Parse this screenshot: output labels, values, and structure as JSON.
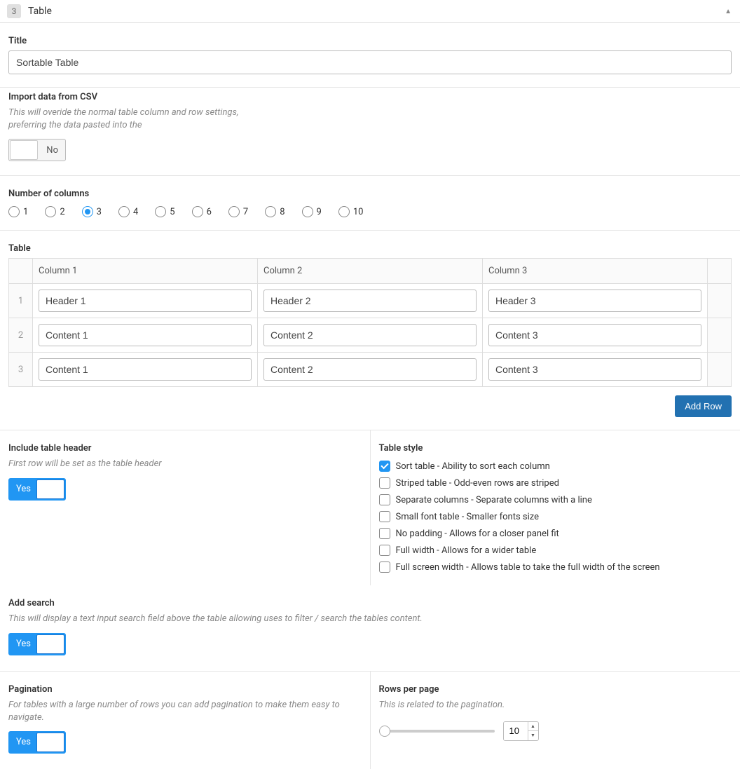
{
  "block": {
    "index": "3",
    "name": "Table",
    "collapse_icon": "▲"
  },
  "title_field": {
    "label": "Title",
    "value": "Sortable Table"
  },
  "csv": {
    "label": "Import data from CSV",
    "desc": "This will overide the normal table column and row settings, preferring the data pasted into the",
    "toggle_value": "No"
  },
  "columns": {
    "label": "Number of columns",
    "options": [
      "1",
      "2",
      "3",
      "4",
      "5",
      "6",
      "7",
      "8",
      "9",
      "10"
    ],
    "selected": "3"
  },
  "table": {
    "label": "Table",
    "headers": [
      "Column 1",
      "Column 2",
      "Column 3"
    ],
    "rows": [
      {
        "num": "1",
        "cells": [
          "Header 1",
          "Header 2",
          "Header 3"
        ]
      },
      {
        "num": "2",
        "cells": [
          "Content 1",
          "Content 2",
          "Content 3"
        ]
      },
      {
        "num": "3",
        "cells": [
          "Content 1",
          "Content 2",
          "Content 3"
        ]
      }
    ],
    "add_row_label": "Add Row"
  },
  "include_header": {
    "label": "Include table header",
    "desc": "First row will be set as the table header",
    "toggle_value": "Yes"
  },
  "style": {
    "label": "Table style",
    "options": [
      {
        "label": "Sort table - Ability to sort each column",
        "checked": true
      },
      {
        "label": "Striped table - Odd-even rows are striped",
        "checked": false
      },
      {
        "label": "Separate columns - Separate columns with a line",
        "checked": false
      },
      {
        "label": "Small font table - Smaller fonts size",
        "checked": false
      },
      {
        "label": "No padding - Allows for a closer panel fit",
        "checked": false
      },
      {
        "label": "Full width - Allows for a wider table",
        "checked": false
      },
      {
        "label": "Full screen width - Allows table to take the full width of the screen",
        "checked": false
      }
    ]
  },
  "search": {
    "label": "Add search",
    "desc": "This will display a text input search field above the table allowing uses to filter / search the tables content.",
    "toggle_value": "Yes"
  },
  "pagination": {
    "label": "Pagination",
    "desc": "For tables with a large number of rows you can add pagination to make them easy to navigate.",
    "toggle_value": "Yes"
  },
  "rows_per_page": {
    "label": "Rows per page",
    "desc": "This is related to the pagination.",
    "value": "10"
  }
}
